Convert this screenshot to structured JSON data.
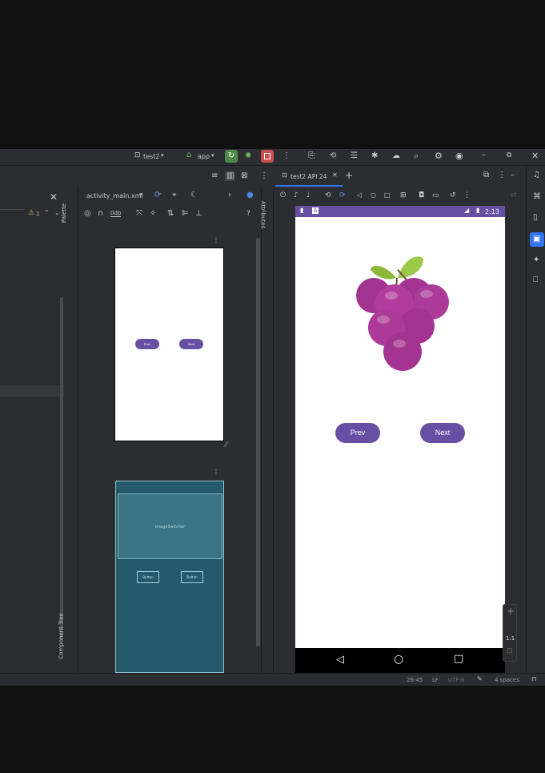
{
  "titlebar": {
    "project": "test2",
    "run_config": "app",
    "icons": [
      "run-icon",
      "debug-icon",
      "stop-icon",
      "more-icon",
      "vcs-icon",
      "translate-icon",
      "layout-icon",
      "bug-icon",
      "cloud-icon",
      "search-icon",
      "settings-icon",
      "account-icon",
      "minimize-icon",
      "restore-icon",
      "close-icon"
    ]
  },
  "editor": {
    "file_tab": "activity_main.xml",
    "palette_label": "Palette",
    "component_tree_label": "Component Tree",
    "attributes_label": "Attributes",
    "margin_value": "0dp",
    "warning_count": "1",
    "help": "?"
  },
  "design_preview": {
    "prev": "Prev",
    "next": "Next"
  },
  "blueprint_preview": {
    "image_switcher": "ImageSwitcher",
    "button1": "Button",
    "button2": "Button"
  },
  "running_devices": {
    "tab": "test2 API 24",
    "add": "+"
  },
  "emulator": {
    "time": "2:13",
    "prev_button": "Prev",
    "next_button": "Next",
    "zoom_ratio": "1:1",
    "zoom_in": "+",
    "colors": {
      "status_bar": "#6750a4",
      "button": "#6750a4",
      "grape": "#a23390",
      "leaf": "#8cb83a"
    }
  },
  "statusbar": {
    "position": "26:45",
    "line_sep": "LF",
    "encoding": "UTF-8",
    "indent": "4 spaces"
  }
}
